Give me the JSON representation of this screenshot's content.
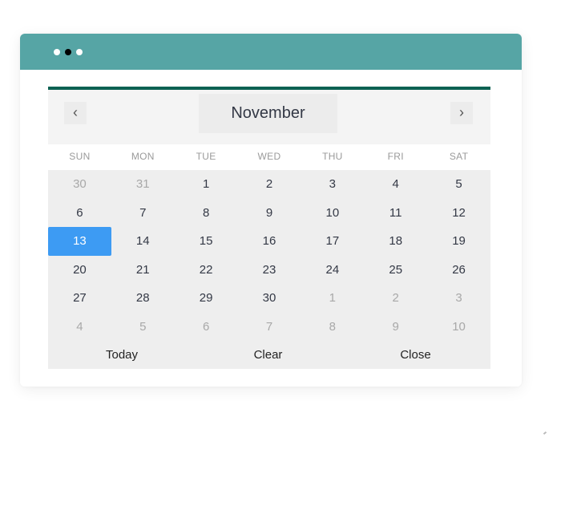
{
  "window": {
    "controls": [
      "close-dot",
      "minimize-dot",
      "maximize-dot"
    ]
  },
  "calendar": {
    "month_label": "November",
    "prev_icon": "‹",
    "next_icon": "›",
    "weekdays": [
      "SUN",
      "MON",
      "TUE",
      "WED",
      "THU",
      "FRI",
      "SAT"
    ],
    "weeks": [
      [
        {
          "d": "30",
          "m": true
        },
        {
          "d": "31",
          "m": true
        },
        {
          "d": "1"
        },
        {
          "d": "2"
        },
        {
          "d": "3"
        },
        {
          "d": "4"
        },
        {
          "d": "5"
        }
      ],
      [
        {
          "d": "6"
        },
        {
          "d": "7"
        },
        {
          "d": "8"
        },
        {
          "d": "9"
        },
        {
          "d": "10"
        },
        {
          "d": "11"
        },
        {
          "d": "12"
        }
      ],
      [
        {
          "d": "13",
          "s": true
        },
        {
          "d": "14"
        },
        {
          "d": "15"
        },
        {
          "d": "16"
        },
        {
          "d": "17"
        },
        {
          "d": "18"
        },
        {
          "d": "19"
        }
      ],
      [
        {
          "d": "20"
        },
        {
          "d": "21"
        },
        {
          "d": "22"
        },
        {
          "d": "23"
        },
        {
          "d": "24"
        },
        {
          "d": "25"
        },
        {
          "d": "26"
        }
      ],
      [
        {
          "d": "27"
        },
        {
          "d": "28"
        },
        {
          "d": "29"
        },
        {
          "d": "30"
        },
        {
          "d": "1",
          "m": true
        },
        {
          "d": "2",
          "m": true
        },
        {
          "d": "3",
          "m": true
        }
      ],
      [
        {
          "d": "4",
          "m": true
        },
        {
          "d": "5",
          "m": true
        },
        {
          "d": "6",
          "m": true
        },
        {
          "d": "7",
          "m": true
        },
        {
          "d": "8",
          "m": true
        },
        {
          "d": "9",
          "m": true
        },
        {
          "d": "10",
          "m": true
        }
      ]
    ],
    "selected_day": "13",
    "footer": {
      "today_label": "Today",
      "clear_label": "Clear",
      "close_label": "Close"
    }
  },
  "colors": {
    "titlebar": "#56a5a5",
    "accent_bar": "#0b6152",
    "selected": "#3d9bf3"
  }
}
